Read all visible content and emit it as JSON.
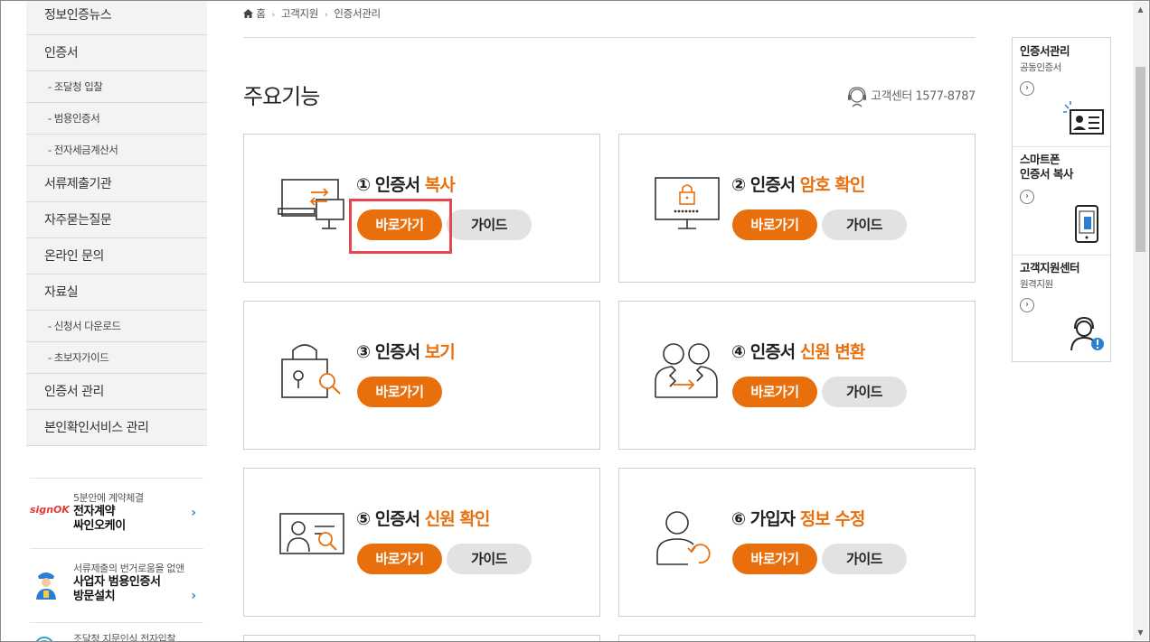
{
  "sidebar": {
    "menu": [
      {
        "label": "정보인증뉴스",
        "sub": false
      },
      {
        "label": "인증서",
        "sub": false
      },
      {
        "label": "- 조달청 입찰",
        "sub": true
      },
      {
        "label": "- 범용인증서",
        "sub": true
      },
      {
        "label": "- 전자세금계산서",
        "sub": true
      },
      {
        "label": "서류제출기관",
        "sub": false
      },
      {
        "label": "자주묻는질문",
        "sub": false
      },
      {
        "label": "온라인 문의",
        "sub": false
      },
      {
        "label": "자료실",
        "sub": false
      },
      {
        "label": "- 신청서 다운로드",
        "sub": true
      },
      {
        "label": "- 초보자가이드",
        "sub": true
      },
      {
        "label": "인증서 관리",
        "sub": false
      },
      {
        "label": "본인확인서비스 관리",
        "sub": false
      }
    ],
    "promos": [
      {
        "small": "5분안에 계약체결",
        "big1": "전자계약",
        "big2": "싸인오케이",
        "logo": "signOK"
      },
      {
        "small": "서류제출의 번거로움을 없앤",
        "big1": "사업자 범용인증서",
        "big2": "방문설치"
      },
      {
        "small": "조달청 지문인식 전자입찰"
      }
    ]
  },
  "breadcrumb": {
    "home": "홈",
    "level1": "고객지원",
    "level2": "인증서관리"
  },
  "page_title": "주요기능",
  "callcenter": "고객센터 1577-8787",
  "cards": [
    {
      "num": "①",
      "title": "인증서",
      "highlight": "복사",
      "go": "바로가기",
      "guide": "가이드"
    },
    {
      "num": "②",
      "title": "인증서",
      "highlight": "암호 확인",
      "go": "바로가기",
      "guide": "가이드"
    },
    {
      "num": "③",
      "title": "인증서",
      "highlight": "보기",
      "go": "바로가기"
    },
    {
      "num": "④",
      "title": "인증서",
      "highlight": "신원 변환",
      "go": "바로가기",
      "guide": "가이드"
    },
    {
      "num": "⑤",
      "title": "인증서",
      "highlight": "신원 확인",
      "go": "바로가기",
      "guide": "가이드"
    },
    {
      "num": "⑥",
      "title": "가입자",
      "highlight": "정보 수정",
      "go": "바로가기",
      "guide": "가이드"
    }
  ],
  "quick": [
    {
      "title": "인증서관리",
      "sub": "공동인증서"
    },
    {
      "title1": "스마트폰",
      "title2": "인증서 복사"
    },
    {
      "title": "고객지원센터",
      "sub": "원격지원"
    }
  ],
  "colors": {
    "accent": "#e96f0c",
    "guide_btn": "#e2e2e2",
    "highlight_box": "#e8474f",
    "badge_blue": "#2a7fd4"
  }
}
